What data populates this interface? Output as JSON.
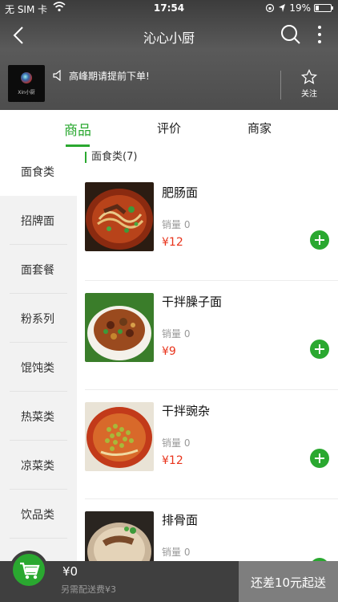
{
  "status": {
    "carrier": "无 SIM 卡",
    "time": "17:54",
    "battery": "19%"
  },
  "nav": {
    "title": "沁心小厨"
  },
  "shop": {
    "logo_text": "Xin小厨",
    "notice": "高峰期请提前下单!",
    "follow_label": "关注"
  },
  "tabs": [
    {
      "label": "商品",
      "active": true
    },
    {
      "label": "评价",
      "active": false
    },
    {
      "label": "商家",
      "active": false
    }
  ],
  "categories": [
    {
      "label": "面食类",
      "active": true
    },
    {
      "label": "招牌面"
    },
    {
      "label": "面套餐"
    },
    {
      "label": "粉系列"
    },
    {
      "label": "馄饨类"
    },
    {
      "label": "热菜类"
    },
    {
      "label": "凉菜类"
    },
    {
      "label": "饮品类"
    }
  ],
  "section": {
    "title": "面食类(7)"
  },
  "items": [
    {
      "name": "肥肠面",
      "sales": "销量 0",
      "price": "¥12",
      "image": "noodle-soup-image"
    },
    {
      "name": "干拌臊子面",
      "sales": "销量 0",
      "price": "¥9",
      "image": "zhaozi-noodles-image"
    },
    {
      "name": "干拌豌杂",
      "sales": "销量 0",
      "price": "¥12",
      "image": "pea-noodles-image"
    },
    {
      "name": "排骨面",
      "sales": "销量 0",
      "price": "",
      "image": "rib-noodles-image"
    }
  ],
  "cart": {
    "total": "¥0",
    "delivery_fee": "另需配送费¥3",
    "checkout_label": "还差10元起送"
  },
  "colors": {
    "accent": "#2aa830",
    "price": "#e8341c",
    "header_bg": "#4d4d4d",
    "bottom_bg": "#3f3f3f"
  }
}
